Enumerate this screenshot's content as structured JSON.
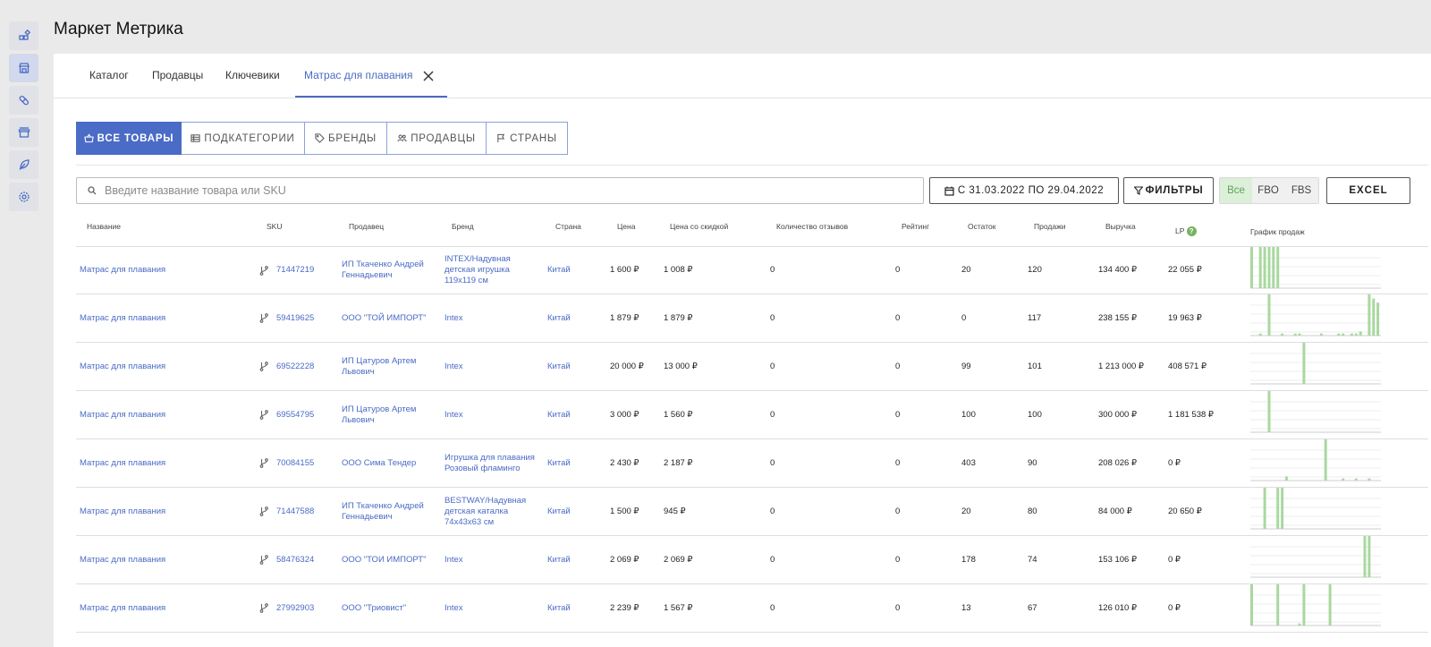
{
  "app": {
    "title": "Маркет Метрика"
  },
  "sidebar": {
    "items": [
      {
        "name": "dashboard",
        "icon": "widgets-icon"
      },
      {
        "name": "market",
        "icon": "store-icon"
      },
      {
        "name": "analytics",
        "icon": "pill-icon"
      },
      {
        "name": "shop",
        "icon": "shop-icon"
      },
      {
        "name": "notes",
        "icon": "leaf-icon"
      },
      {
        "name": "settings",
        "icon": "gear-icon"
      }
    ]
  },
  "tabs": [
    {
      "label": "Каталог"
    },
    {
      "label": "Продавцы"
    },
    {
      "label": "Ключевики"
    },
    {
      "label": "Матрас для плавания",
      "active": true
    }
  ],
  "views": [
    {
      "label": "ВСЕ ТОВАРЫ",
      "icon": "basket-icon",
      "active": true
    },
    {
      "label": "ПОДКАТЕГОРИИ",
      "icon": "list-icon"
    },
    {
      "label": "БРЕНДЫ",
      "icon": "tag-icon"
    },
    {
      "label": "ПРОДАВЦЫ",
      "icon": "people-icon"
    },
    {
      "label": "СТРАНЫ",
      "icon": "flag-icon"
    }
  ],
  "search": {
    "placeholder": "Введите название товара или SKU",
    "value": ""
  },
  "date_range": "С 31.03.2022 ПО 29.04.2022",
  "filters_label": "ФИЛЬТРЫ",
  "fulfilment": {
    "options": [
      "Все",
      "FBO",
      "FBS"
    ],
    "selected": "Все"
  },
  "excel_label": "EXCEL",
  "colors": {
    "accent": "#4a6bc6",
    "bar": "#a9d8a0",
    "selected_green": "#5ba65a"
  },
  "table": {
    "headers": {
      "name": "Название",
      "sku": "SKU",
      "seller": "Продавец",
      "brand": "Бренд",
      "country": "Страна",
      "price": "Цена",
      "discount_price": "Цена со скидкой",
      "reviews": "Количество отзывов",
      "rating": "Рейтинг",
      "stock": "Остаток",
      "sales": "Продажи",
      "revenue": "Выручка",
      "lp": "LP",
      "chart": "График продаж"
    },
    "rows": [
      {
        "name": "Матрас для плавания",
        "sku": "71447219",
        "seller": "ИП Ткаченко Андрей Геннадьевич",
        "brand": "INTEX/Надувная детская игрушка 119x119 см",
        "country": "Китай",
        "price": "1 600 ₽",
        "discount_price": "1 008 ₽",
        "reviews": "0",
        "rating": "0",
        "stock": "20",
        "sales": "120",
        "revenue": "134 400 ₽",
        "lp": "22 055 ₽",
        "sales_series": [
          20,
          0,
          20,
          20,
          20,
          20,
          20,
          0,
          0,
          0,
          0,
          0,
          0,
          0,
          0,
          0,
          0,
          0,
          0,
          0,
          0,
          0,
          0,
          0,
          0,
          0,
          0,
          0,
          0,
          0
        ]
      },
      {
        "name": "Матрас для плавания",
        "sku": "59419625",
        "seller": "ООО \"ТОЙ ИМПОРТ\"",
        "brand": "Intex",
        "country": "Китай",
        "price": "1 879 ₽",
        "discount_price": "1 879 ₽",
        "reviews": "0",
        "rating": "0",
        "stock": "0",
        "sales": "117",
        "revenue": "238 155 ₽",
        "lp": "19 963 ₽",
        "sales_series": [
          0,
          0,
          1,
          0,
          20,
          0,
          0,
          1,
          0,
          0,
          1,
          1,
          0,
          0,
          0,
          0,
          1,
          0,
          0,
          0,
          1,
          1,
          0,
          1,
          1,
          2,
          0,
          20,
          18,
          16
        ]
      },
      {
        "name": "Матрас для плавания",
        "sku": "69522228",
        "seller": "ИП Цатуров Артем Львович",
        "brand": "Intex",
        "country": "Китай",
        "price": "20 000 ₽",
        "discount_price": "13 000 ₽",
        "reviews": "0",
        "rating": "0",
        "stock": "99",
        "sales": "101",
        "revenue": "1 213 000 ₽",
        "lp": "408 571 ₽",
        "sales_series": [
          0,
          0,
          0,
          0,
          0,
          0,
          0,
          0,
          0,
          0,
          0,
          0,
          20,
          0,
          0,
          0,
          0,
          0,
          0,
          0,
          0,
          0,
          0,
          0,
          0,
          0,
          0,
          0,
          0,
          0
        ]
      },
      {
        "name": "Матрас для плавания",
        "sku": "69554795",
        "seller": "ИП Цатуров Артем Львович",
        "brand": "Intex",
        "country": "Китай",
        "price": "3 000 ₽",
        "discount_price": "1 560 ₽",
        "reviews": "0",
        "rating": "0",
        "stock": "100",
        "sales": "100",
        "revenue": "300 000 ₽",
        "lp": "1 181 538 ₽",
        "sales_series": [
          0,
          0,
          0,
          0,
          20,
          0,
          0,
          0,
          0,
          0,
          0,
          0,
          0,
          0,
          0,
          0,
          0,
          0,
          0,
          0,
          0,
          0,
          0,
          0,
          0,
          0,
          0,
          0,
          0,
          0
        ]
      },
      {
        "name": "Матрас для плавания",
        "sku": "70084155",
        "seller": "ООО Сима Тендер",
        "brand": "Игрушка для плавания Розовый фламинго",
        "country": "Китай",
        "price": "2 430 ₽",
        "discount_price": "2 187 ₽",
        "reviews": "0",
        "rating": "0",
        "stock": "403",
        "sales": "90",
        "revenue": "208 026 ₽",
        "lp": "0 ₽",
        "sales_series": [
          0,
          0,
          0,
          0,
          0,
          0,
          0,
          0,
          2,
          0,
          0,
          0,
          0,
          0,
          0,
          0,
          0,
          20,
          0,
          0,
          0,
          1,
          0,
          0,
          1,
          0,
          0,
          1,
          0,
          0
        ]
      },
      {
        "name": "Матрас для плавания",
        "sku": "71447588",
        "seller": "ИП Ткаченко Андрей Геннадьевич",
        "brand": "BESTWAY/Надувная детская каталка 74x43x63 см",
        "country": "Китай",
        "price": "1 500 ₽",
        "discount_price": "945 ₽",
        "reviews": "0",
        "rating": "0",
        "stock": "20",
        "sales": "80",
        "revenue": "84 000 ₽",
        "lp": "20 650 ₽",
        "sales_series": [
          0,
          0,
          0,
          20,
          0,
          0,
          20,
          20,
          0,
          0,
          0,
          0,
          0,
          0,
          0,
          0,
          0,
          0,
          0,
          0,
          0,
          0,
          0,
          0,
          0,
          0,
          0,
          0,
          0,
          0
        ]
      },
      {
        "name": "Матрас для плавания",
        "sku": "58476324",
        "seller": "ООО \"ТОИ ИМПОРТ\"",
        "brand": "Intex",
        "country": "Китай",
        "price": "2 069 ₽",
        "discount_price": "2 069 ₽",
        "reviews": "0",
        "rating": "0",
        "stock": "178",
        "sales": "74",
        "revenue": "153 106 ₽",
        "lp": "0 ₽",
        "sales_series": [
          0,
          0,
          0,
          0,
          0,
          0,
          0,
          0,
          0,
          0,
          0,
          0,
          0,
          0,
          0,
          0,
          0,
          0,
          0,
          0,
          0,
          0,
          0,
          0,
          0,
          0,
          20,
          20,
          0,
          0
        ]
      },
      {
        "name": "Матрас для плавания",
        "sku": "27992903",
        "seller": "ООО \"Триовист\"",
        "brand": "Intex",
        "country": "Китай",
        "price": "2 239 ₽",
        "discount_price": "1 567 ₽",
        "reviews": "0",
        "rating": "0",
        "stock": "13",
        "sales": "67",
        "revenue": "126 010 ₽",
        "lp": "0 ₽",
        "sales_series": [
          20,
          0,
          0,
          0,
          0,
          0,
          20,
          0,
          0,
          0,
          0,
          1,
          20,
          0,
          0,
          0,
          0,
          0,
          20,
          0,
          0,
          0,
          0,
          0,
          0,
          0,
          0,
          0,
          0,
          0
        ]
      }
    ]
  }
}
